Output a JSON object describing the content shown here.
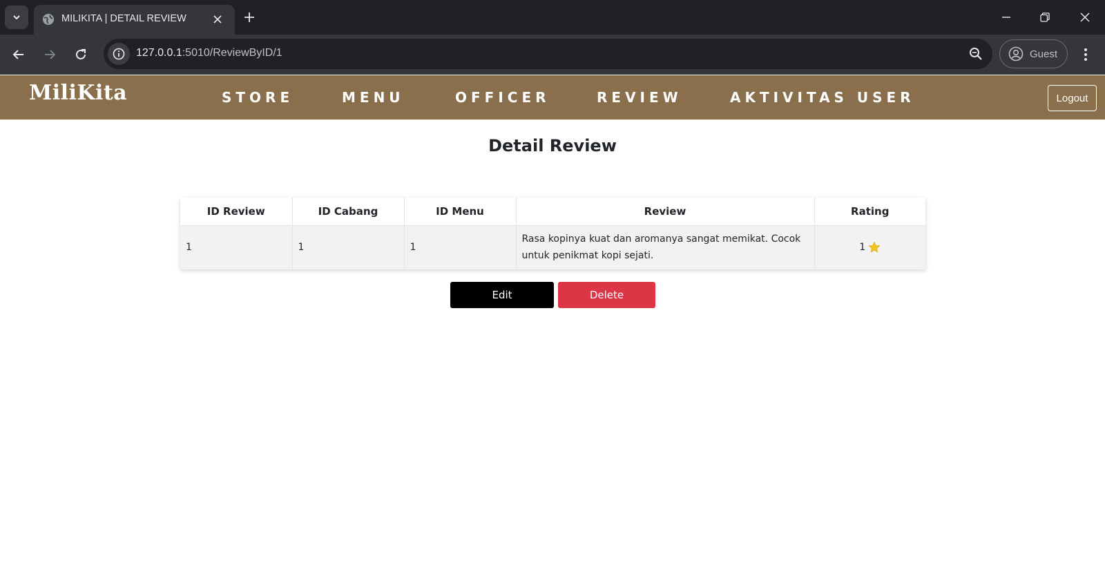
{
  "browser": {
    "tab_title": "MILIKITA | DETAIL REVIEW",
    "url_host": "127.0.0.1",
    "url_path": ":5010/ReviewByID/1",
    "profile_label": "Guest"
  },
  "site": {
    "brand": "MiliKita",
    "nav": [
      "STORE",
      "MENU",
      "OFFICER",
      "REVIEW",
      "AKTIVITAS USER"
    ],
    "logout_label": "Logout",
    "header_color": "#8a6f4d"
  },
  "main": {
    "title": "Detail Review",
    "table": {
      "headers": [
        "ID Review",
        "ID Cabang",
        "ID Menu",
        "Review",
        "Rating"
      ],
      "row": {
        "id_review": "1",
        "id_cabang": "1",
        "id_menu": "1",
        "review": "Rasa kopinya kuat dan aromanya sangat memikat. Cocok untuk penikmat kopi sejati.",
        "rating": "1",
        "rating_icon": "star-icon"
      }
    },
    "buttons": {
      "edit": "Edit",
      "delete": "Delete",
      "delete_color": "#dc3545"
    }
  }
}
